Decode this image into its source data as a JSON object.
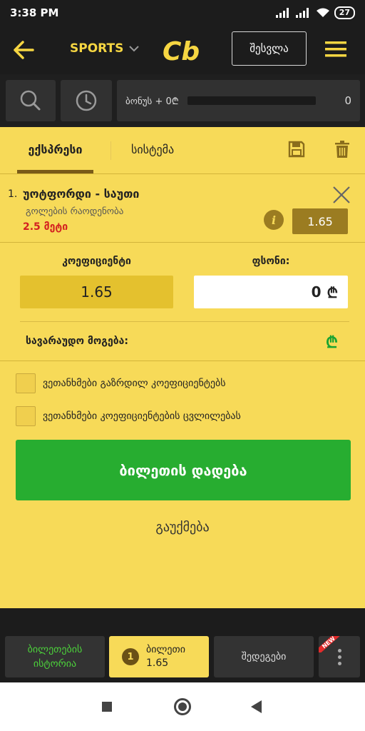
{
  "status_bar": {
    "time": "3:38 PM",
    "battery": "27"
  },
  "header": {
    "sports_label": "SPORTS",
    "logo_text": "Cb",
    "login_label": "შესვლა"
  },
  "toolbar": {
    "bonus_label": "ბონუს + 0₾",
    "bonus_value": "0"
  },
  "betslip": {
    "tabs": [
      {
        "label": "ექსპრესი",
        "active": true
      },
      {
        "label": "სისტემა",
        "active": false
      }
    ],
    "bet": {
      "number": "1.",
      "teams": "უოტფორდი - საუთი",
      "market": "გოლების რაოდენობა",
      "pick": "2.5 მეტი",
      "odd": "1.65"
    },
    "coefficient_label": "კოეფიციენტი",
    "coefficient_value": "1.65",
    "stake_label": "ფსონი:",
    "stake_value": "0",
    "currency": "₾",
    "potential_win_label": "სავარაუდო მოგება:",
    "potential_win_value": "₾",
    "checkbox_1": "ვეთანხმები გაზრდილ კოეფიციენტებს",
    "checkbox_2": "ვეთანხმები კოეფიციენტების ცვლილებას",
    "place_bet_label": "ბილეთის დადება",
    "cancel_label": "გაუქმება"
  },
  "bottom_nav": {
    "history_line1": "ბილეთების",
    "history_line2": "ისტორია",
    "ticket_count": "1",
    "ticket_label": "ბილეთი",
    "ticket_odd": "1.65",
    "results_label": "შედეგები",
    "new_badge": "NEW"
  },
  "colors": {
    "accent_yellow": "#f7da58",
    "button_green": "#27ad30",
    "pick_red": "#d32020",
    "dark_bg": "#1c1c1c"
  }
}
